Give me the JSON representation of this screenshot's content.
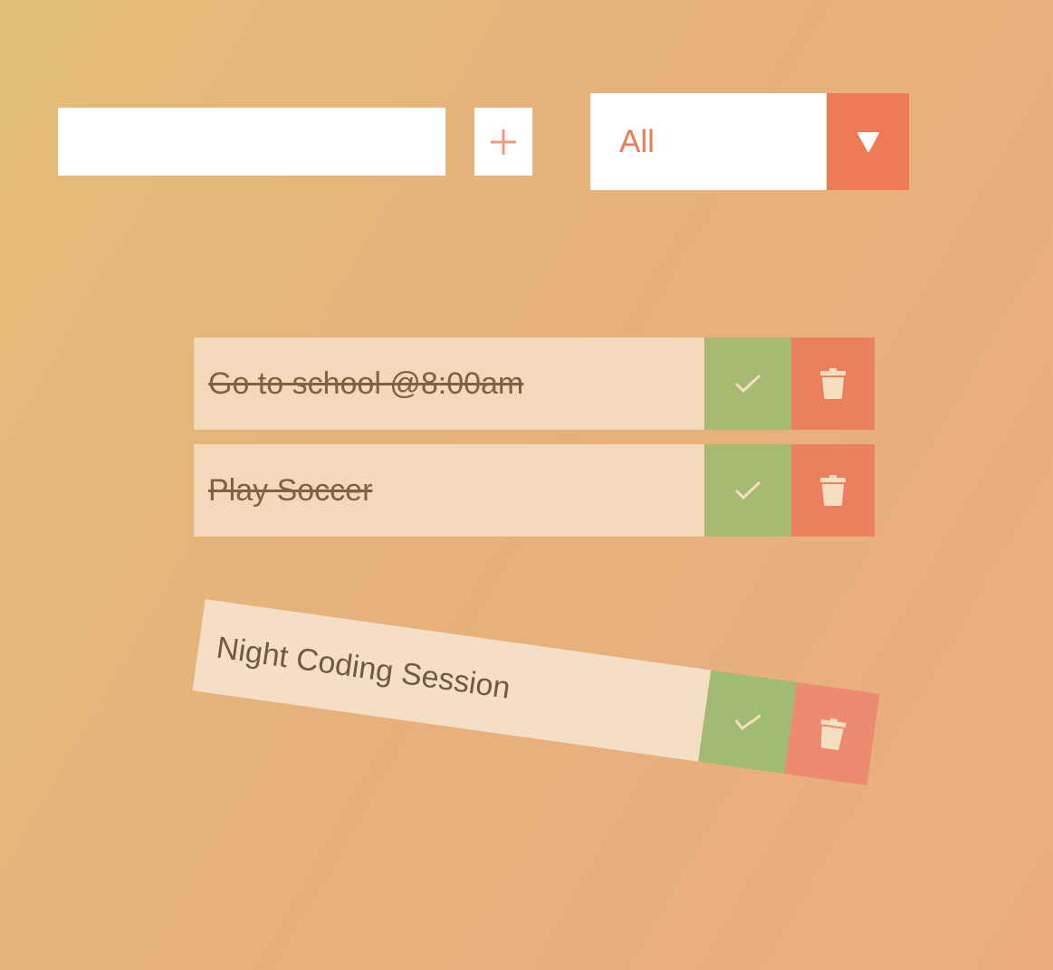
{
  "form": {
    "input_value": "",
    "add_label": "+",
    "filter": {
      "selected": "All"
    }
  },
  "todos": [
    {
      "text": "Go to school @8:00am",
      "completed": true
    },
    {
      "text": "Play Soccer",
      "completed": true
    },
    {
      "text": "Night Coding Session",
      "completed": false
    }
  ],
  "colors": {
    "accent": "#ee7a56",
    "complete": "#a6ba72",
    "delete": "#ec7f5d",
    "item_bg": "#f2d9bc",
    "item_text": "#7d6243"
  },
  "icons": {
    "add": "plus-icon",
    "filter": "caret-down-icon",
    "complete": "check-icon",
    "delete": "trash-icon"
  }
}
